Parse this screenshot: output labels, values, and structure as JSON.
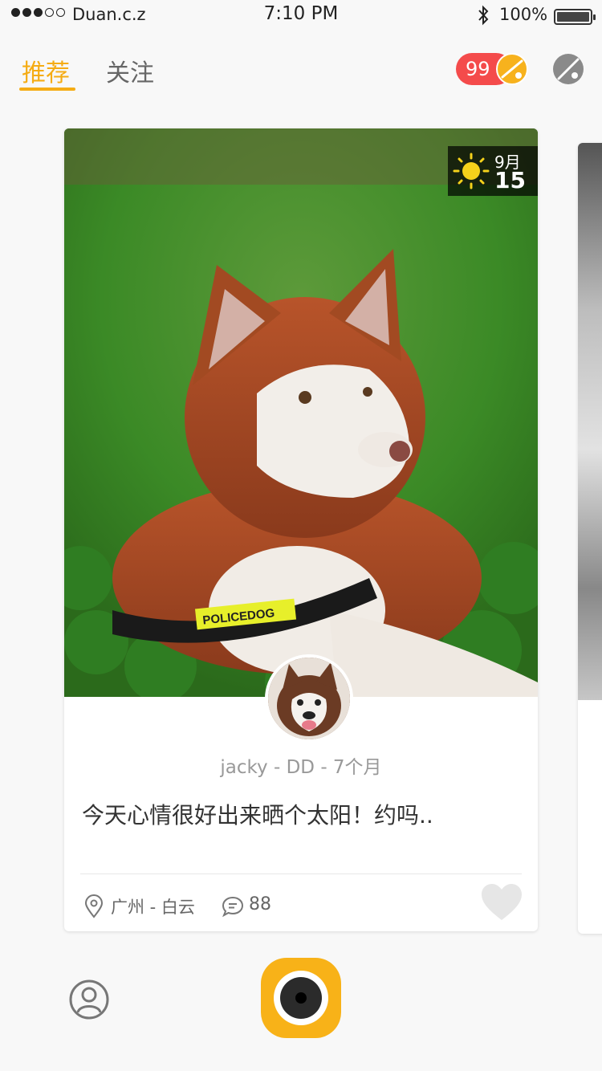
{
  "status_bar": {
    "carrier": "Duan.c.z",
    "time": "7:10 PM",
    "battery": "100%",
    "signal_bars_filled": 3,
    "signal_bars_total": 5
  },
  "nav": {
    "tabs": [
      {
        "label": "推荐",
        "active": true
      },
      {
        "label": "关注",
        "active": false
      }
    ],
    "message_count": "99"
  },
  "card": {
    "date": {
      "month": "9月",
      "day": "15",
      "weather": "sunny"
    },
    "collar_text": "POLICEDOG",
    "meta": "jacky - DD - 7个月",
    "text": "今天心情很好出来晒个太阳！约吗..",
    "location": "广州 - 白云",
    "comment_count": "88"
  },
  "colors": {
    "accent": "#f5ac14",
    "badge_red": "#f44b4b"
  }
}
